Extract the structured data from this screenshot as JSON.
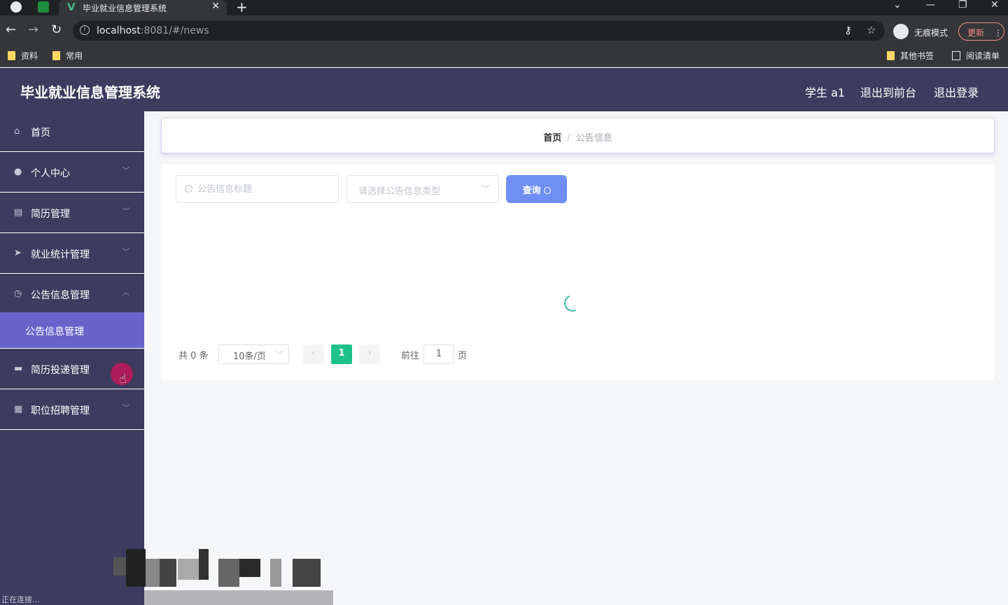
{
  "browser": {
    "tab_title": "毕业就业信息管理系统",
    "url_host": "localhost",
    "url_rest": ":8081/#/news",
    "incognito_label": "无痕模式",
    "update_label": "更新",
    "bookmarks": [
      "资料",
      "常用"
    ],
    "other_bookmarks": "其他书签",
    "reading_list": "阅读清单",
    "status_text": "正在连接..."
  },
  "header": {
    "title": "毕业就业信息管理系统",
    "user": "学生 a1",
    "back_to_front": "退出到前台",
    "logout": "退出登录"
  },
  "sidebar": {
    "items": [
      {
        "label": "首页",
        "icon": "home-icon"
      },
      {
        "label": "个人中心",
        "icon": "user-icon"
      },
      {
        "label": "简历管理",
        "icon": "document-icon"
      },
      {
        "label": "就业统计管理",
        "icon": "send-icon"
      },
      {
        "label": "公告信息管理",
        "icon": "clock-icon"
      },
      {
        "label": "简历投递管理",
        "icon": "briefcase-icon"
      },
      {
        "label": "职位招聘管理",
        "icon": "grid-icon"
      }
    ],
    "submenu": {
      "label": "公告信息管理"
    }
  },
  "breadcrumb": {
    "home": "首页",
    "separator": "/",
    "current": "公告信息"
  },
  "search": {
    "title_placeholder": "公告信息标题",
    "type_placeholder": "请选择公告信息类型",
    "query_label": "查询"
  },
  "pagination": {
    "total": "共 0 条",
    "page_size": "10条/页",
    "current_page": "1",
    "goto_label": "前往",
    "goto_value": "1",
    "page_suffix": "页"
  },
  "colors": {
    "header_bg": "#3d3b5e",
    "active_submenu": "#6b63c9",
    "query_button": "#6f8ef6",
    "active_page": "#1ec28b"
  }
}
